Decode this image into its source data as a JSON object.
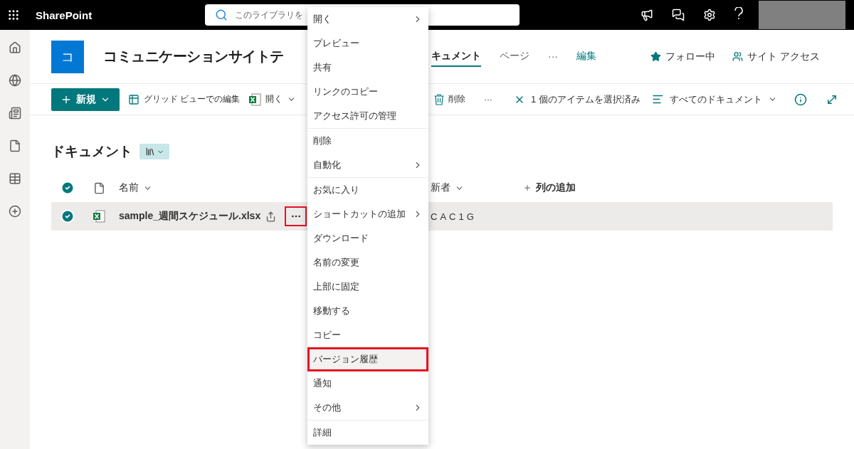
{
  "app_bar": {
    "app_name": "SharePoint",
    "search_placeholder": "このライブラリを"
  },
  "site": {
    "logo_letter": "コ",
    "title": "コミュニケーションサイトテ"
  },
  "nav": [
    {
      "label": "キュメント",
      "kind": "tab",
      "selected": true
    },
    {
      "label": "ページ",
      "kind": "tab",
      "selected": false
    },
    {
      "label": "···",
      "kind": "more",
      "selected": false
    },
    {
      "label": "編集",
      "kind": "link",
      "selected": false
    }
  ],
  "site_actions": [
    {
      "label": "フォロー中",
      "kind": "follow"
    },
    {
      "label": "サイト アクセス",
      "kind": "access"
    }
  ],
  "command_bar": {
    "new_label": "新規",
    "left": [
      {
        "label": "グリッド ビューでの編集",
        "kind": "grid",
        "caret": false
      },
      {
        "label": "開く",
        "kind": "excel",
        "caret": true
      }
    ],
    "right": [
      {
        "label": "削除",
        "kind": "delete"
      },
      {
        "label": "···",
        "kind": "more"
      }
    ],
    "selection": "1 個のアイテムを選択済み",
    "view": "すべてのドキュメント"
  },
  "library": {
    "title": "ドキュメント",
    "columns": [
      {
        "label": "名前",
        "kind": "name"
      },
      {
        "label": "新者",
        "kind": "sortable"
      },
      {
        "label": "列の追加",
        "kind": "add"
      }
    ],
    "all_checked": true,
    "rows": [
      {
        "name": "sample_週間スケジュール.xlsx",
        "modified_by": "CAC1G",
        "checked": true,
        "more_annotated": true
      }
    ]
  },
  "context_menu": {
    "groups": [
      [
        {
          "label": "開く",
          "submenu": true,
          "selected": false,
          "annotated": false
        },
        {
          "label": "プレビュー",
          "submenu": false,
          "selected": false,
          "annotated": false
        },
        {
          "label": "共有",
          "submenu": false,
          "selected": false,
          "annotated": false
        },
        {
          "label": "リンクのコピー",
          "submenu": false,
          "selected": false,
          "annotated": false
        },
        {
          "label": "アクセス許可の管理",
          "submenu": false,
          "selected": false,
          "annotated": false
        }
      ],
      [
        {
          "label": "削除",
          "submenu": false,
          "selected": false,
          "annotated": false
        },
        {
          "label": "自動化",
          "submenu": true,
          "selected": false,
          "annotated": false
        }
      ],
      [
        {
          "label": "お気に入り",
          "submenu": false,
          "selected": false,
          "annotated": false
        },
        {
          "label": "ショートカットの追加",
          "submenu": true,
          "selected": false,
          "annotated": false
        },
        {
          "label": "ダウンロード",
          "submenu": false,
          "selected": false,
          "annotated": false
        },
        {
          "label": "名前の変更",
          "submenu": false,
          "selected": false,
          "annotated": false
        },
        {
          "label": "上部に固定",
          "submenu": false,
          "selected": false,
          "annotated": false
        },
        {
          "label": "移動する",
          "submenu": false,
          "selected": false,
          "annotated": false
        },
        {
          "label": "コピー",
          "submenu": false,
          "selected": false,
          "annotated": false
        },
        {
          "label": "バージョン履歴",
          "submenu": false,
          "selected": true,
          "annotated": true
        },
        {
          "label": "通知",
          "submenu": false,
          "selected": false,
          "annotated": false
        },
        {
          "label": "その他",
          "submenu": true,
          "selected": false,
          "annotated": false
        }
      ],
      [
        {
          "label": "詳細",
          "submenu": false,
          "selected": false,
          "annotated": false
        }
      ]
    ]
  }
}
